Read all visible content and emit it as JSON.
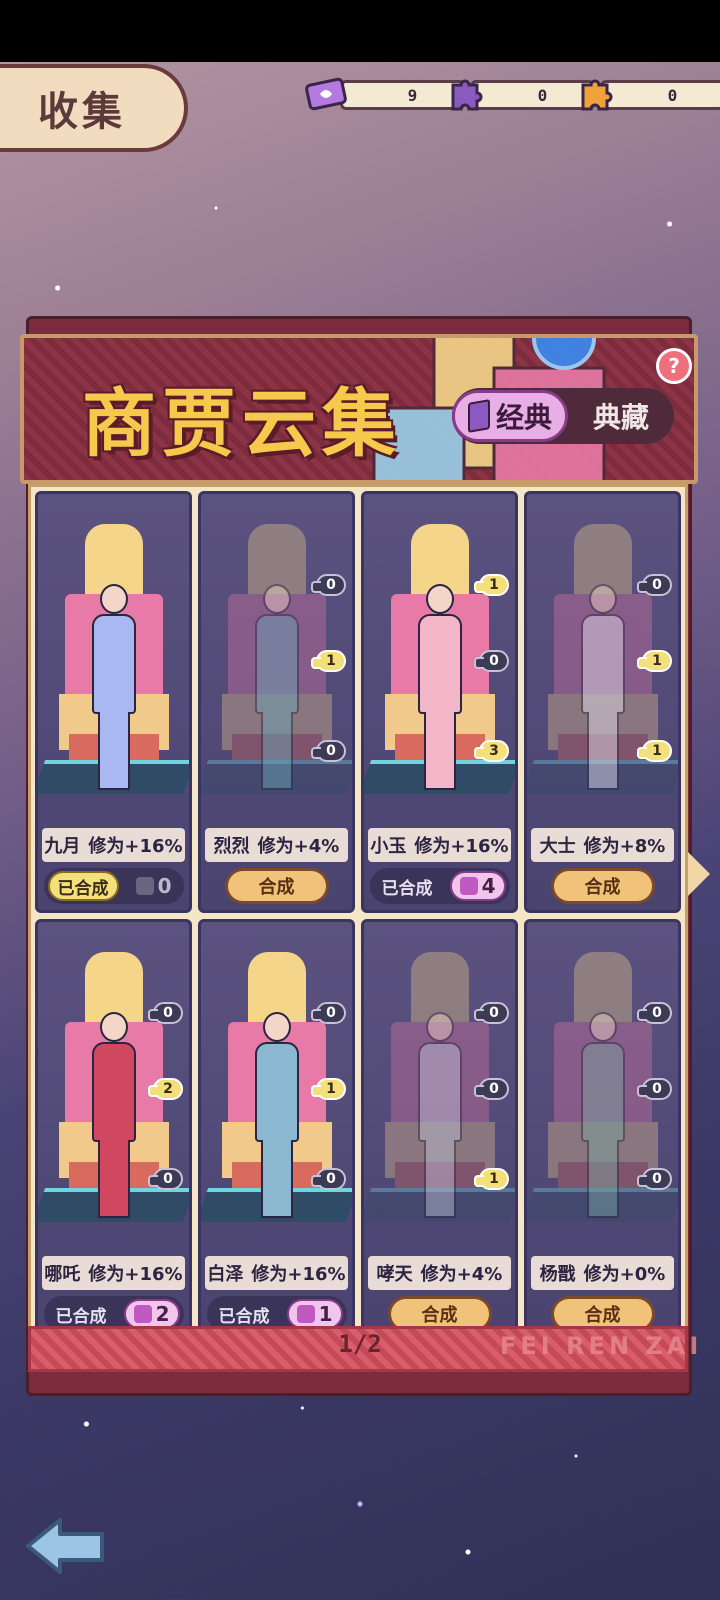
{
  "header": {
    "title": "收集"
  },
  "currencies": [
    {
      "icon": "ticket-icon",
      "value": "9",
      "color": "#b47ae0"
    },
    {
      "icon": "purple-puzzle-icon",
      "value": "0",
      "color": "#8a5ac0"
    },
    {
      "icon": "orange-puzzle-icon",
      "value": "0",
      "color": "#f0a23a"
    }
  ],
  "banner": {
    "title": "商贾云集",
    "tabs": {
      "active": "经典",
      "inactive": "典藏"
    },
    "help": "?"
  },
  "cards": [
    {
      "name": "九月",
      "bonus": "修为+16%",
      "status": "已合成",
      "collected": true,
      "pieces": "0",
      "active": true,
      "slots": [],
      "color": "#a9b8f0"
    },
    {
      "name": "烈烈",
      "bonus": "修为+4%",
      "action": "合成",
      "collected": false,
      "slots": [
        "0",
        "1",
        "0"
      ],
      "color": "#6aa9b8"
    },
    {
      "name": "小玉",
      "bonus": "修为+16%",
      "status": "已合成",
      "collected": true,
      "pieces": "4",
      "active": false,
      "slots": [
        "1",
        "0",
        "3"
      ],
      "color": "#f2b6c8"
    },
    {
      "name": "大士",
      "bonus": "修为+8%",
      "action": "合成",
      "collected": false,
      "slots": [
        "0",
        "1",
        "1"
      ],
      "color": "#e8e4f0"
    },
    {
      "name": "哪吒",
      "bonus": "修为+16%",
      "status": "已合成",
      "collected": true,
      "pieces": "2",
      "active": false,
      "slots": [
        "0",
        "2",
        "0"
      ],
      "color": "#d04860"
    },
    {
      "name": "白泽",
      "bonus": "修为+16%",
      "status": "已合成",
      "collected": true,
      "pieces": "1",
      "active": false,
      "slots": [
        "0",
        "1",
        "0"
      ],
      "color": "#8ab8d0"
    },
    {
      "name": "哮天",
      "bonus": "修为+4%",
      "action": "合成",
      "collected": false,
      "slots": [
        "0",
        "0",
        "1"
      ],
      "color": "#c0c4d8"
    },
    {
      "name": "杨戬",
      "bonus": "修为+0%",
      "action": "合成",
      "collected": false,
      "slots": [
        "0",
        "0",
        "0"
      ],
      "color": "#7aa8a0"
    }
  ],
  "footer": {
    "page": "1/2",
    "brand": "FEI REN ZAI"
  }
}
